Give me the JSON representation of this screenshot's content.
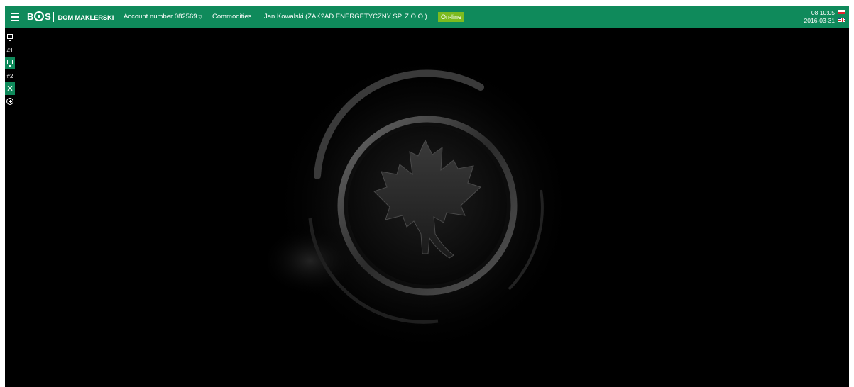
{
  "header": {
    "logo_brand": "B",
    "logo_brand_end": "S",
    "logo_text": "DOM MAKLERSKI",
    "account_label": "Account number 082569",
    "account_caret": "▽",
    "commodities_label": "Commodities",
    "user": "Jan Kowalski (ZAK?AD ENERGETYCZNY SP. Z O.O.)",
    "status": "On-line",
    "time": "08:10:05",
    "date": "2016-03-31"
  },
  "colors": {
    "accent": "#0f8a5b",
    "status_badge": "#7dbb1f",
    "background": "#000000"
  },
  "icons": {
    "menu": "hamburger-icon",
    "workspace": "monitor-icon",
    "close": "close-icon",
    "add": "add-circle-icon",
    "flag_pl": "flag-pl-icon",
    "flag_en": "flag-en-icon",
    "emblem": "maple-leaf-emblem"
  },
  "sidebar": {
    "items": [
      {
        "type": "monitor",
        "active": false
      },
      {
        "type": "label",
        "label": "#1"
      },
      {
        "type": "monitor",
        "active": true
      },
      {
        "type": "label",
        "label": "#2"
      },
      {
        "type": "close",
        "active": true
      },
      {
        "type": "add",
        "active": false
      }
    ]
  }
}
